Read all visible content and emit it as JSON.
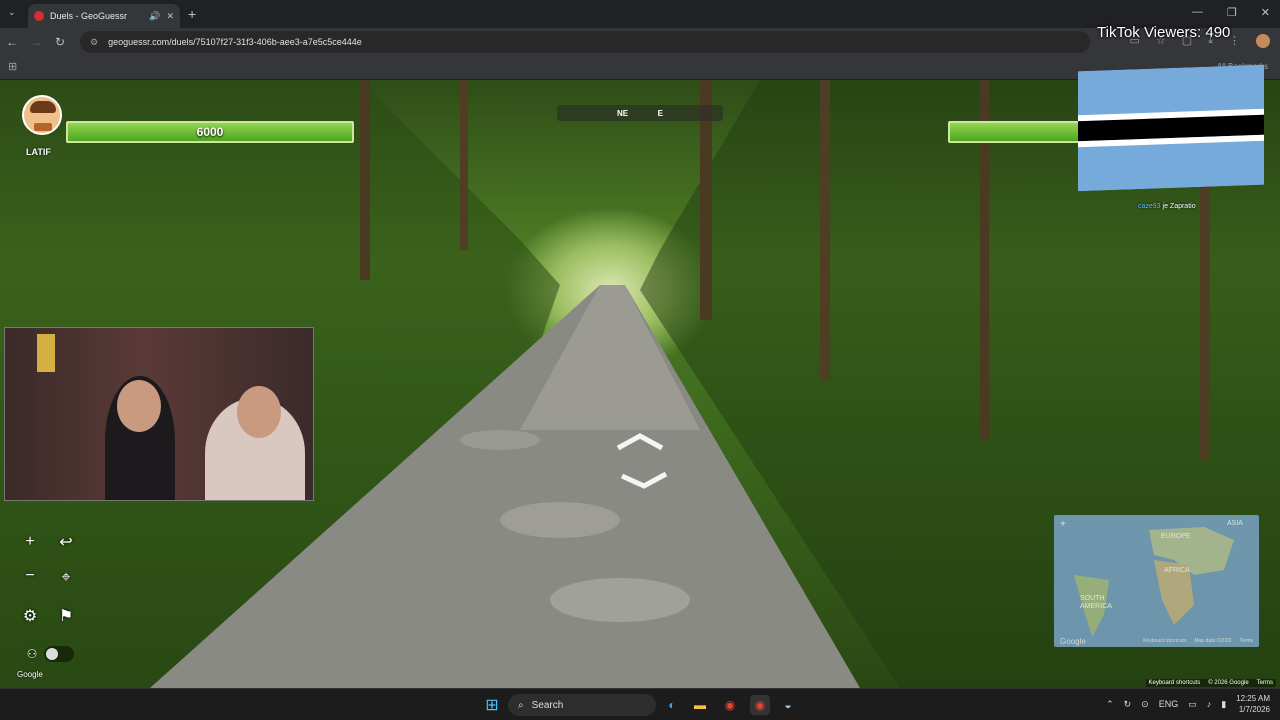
{
  "browser": {
    "tab_title": "Duels - GeoGuessr",
    "url": "geoguessr.com/duels/75107f27-31f3-406b-aee3-a7e5c5ce444e",
    "bookmarks_label": "All Bookmarks"
  },
  "overlay": {
    "tiktok_viewers": "TikTok Viewers: 490"
  },
  "game": {
    "compass": {
      "left": "NE",
      "right": "E"
    },
    "player": {
      "name": "LATIF",
      "health": "6000"
    },
    "opponent_flag_colors": {
      "blue": "#75aadb",
      "black": "#000000",
      "white": "#ffffff"
    },
    "feed": {
      "user": "caze93",
      "text": " je Zapratio"
    }
  },
  "minimap": {
    "labels": {
      "asia": "ASIA",
      "europe": "EUROPE",
      "africa": "AFRICA",
      "south_america": "SOUTH AMERICA"
    },
    "google": "Google",
    "shortcuts": "Keyboard shortcuts",
    "map_data": "Map data ©2026",
    "terms": "Terms"
  },
  "streetview": {
    "google_logo": "Google",
    "shortcuts": "Keyboard shortcuts",
    "copyright": "© 2026 Google",
    "terms": "Terms"
  },
  "taskbar": {
    "search_label": "Search",
    "lang": "ENG",
    "time": "12:25 AM",
    "date": "1/7/2026"
  }
}
